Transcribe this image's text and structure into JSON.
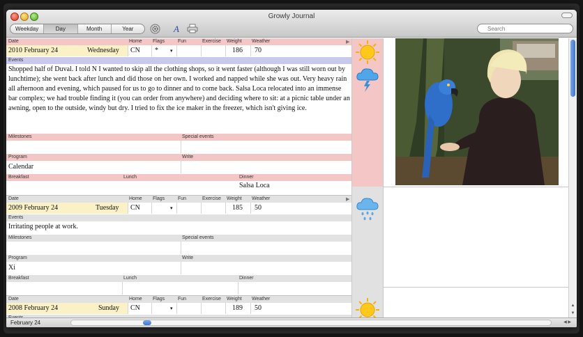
{
  "window": {
    "title": "Growly Journal",
    "search_placeholder": "Search"
  },
  "toolbar": {
    "views": [
      "Weekday",
      "Day",
      "Month",
      "Year"
    ],
    "active_view": "Day",
    "tools": [
      "gear-icon",
      "font-icon",
      "print-icon"
    ]
  },
  "headers": {
    "date": "Date",
    "home": "Home",
    "flags": "Flags",
    "fun": "Fun",
    "exercise": "Exercise",
    "weight": "Weight",
    "weather": "Weather",
    "events": "Events",
    "milestones": "Milestones",
    "special_events": "Special events",
    "program": "Program",
    "write": "Write",
    "breakfast": "Breakfast",
    "lunch": "Lunch",
    "dinner": "Dinner"
  },
  "entries": [
    {
      "date": "2010 February 24",
      "weekday": "Wednesday",
      "home": "CN",
      "flags": "*",
      "fun": "",
      "exercise": "",
      "weight": "186",
      "weather": "70",
      "weather_icons": [
        "sun-icon",
        "rain-cloud-lightning-icon"
      ],
      "events": "Shopped half of Duval. I told N I wanted to skip all the clothing shops, so it went faster (although I was still worn out by lunchtime); she went back after lunch and did those on her own. I worked and napped while she was out. Very heavy rain all afternoon and evening, which paused for us to go to dinner and to come back. Salsa Loca relocated into an immense bar complex; we had trouble finding it (you can order from anywhere) and deciding where to sit: at a picnic table under an awning, open to the outside, windy but dry. I tried to fix the ice maker in the freezer, which isn't giving ice.",
      "milestones": "",
      "special_events": "",
      "program": "Calendar",
      "write": "",
      "breakfast": "",
      "lunch": "",
      "dinner": "Salsa Loca"
    },
    {
      "date": "2009 February 24",
      "weekday": "Tuesday",
      "home": "CN",
      "flags": "",
      "fun": "",
      "exercise": "",
      "weight": "185",
      "weather": "50",
      "weather_icons": [
        "rain-cloud-icon"
      ],
      "events": "Irritating people at work.",
      "milestones": "",
      "special_events": "",
      "program": "Xi",
      "write": "",
      "breakfast": "",
      "lunch": "",
      "dinner": ""
    },
    {
      "date": "2008 February 24",
      "weekday": "Sunday",
      "home": "CN",
      "flags": "",
      "fun": "",
      "exercise": "",
      "weight": "189",
      "weather": "50",
      "weather_icons": [
        "sun-icon"
      ],
      "events": ""
    }
  ],
  "status": {
    "current_date": "February 24"
  },
  "colors": {
    "selected_header": "#f5c6c6",
    "selected_date": "#fbf1c6",
    "events_bar_selected": "#c9c9ee",
    "header_gray": "#e2e2e2",
    "date_yellow": "#fbf1c6"
  }
}
